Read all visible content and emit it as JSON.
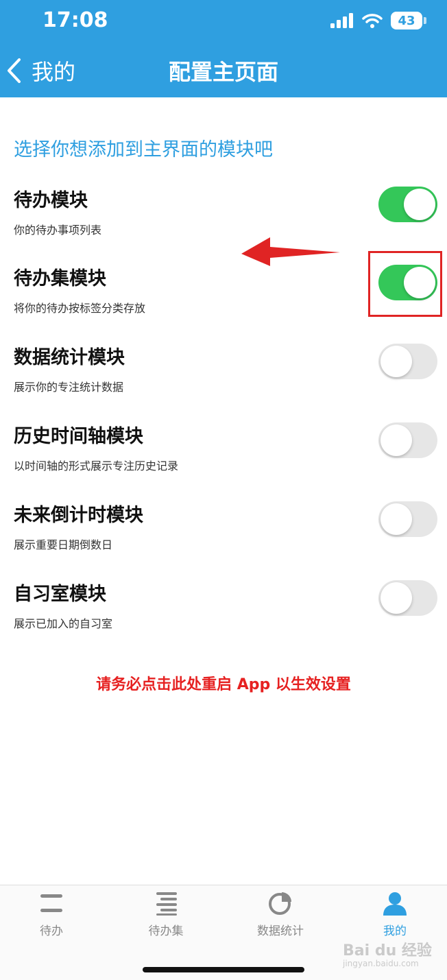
{
  "status_bar": {
    "time": "17:08",
    "battery": "43"
  },
  "nav": {
    "back_label": "我的",
    "title": "配置主页面"
  },
  "section_title": "选择你想添加到主界面的模块吧",
  "modules": [
    {
      "title": "待办模块",
      "desc": "你的待办事项列表",
      "enabled": true
    },
    {
      "title": "待办集模块",
      "desc": "将你的待办按标签分类存放",
      "enabled": true
    },
    {
      "title": "数据统计模块",
      "desc": "展示你的专注统计数据",
      "enabled": false
    },
    {
      "title": "历史时间轴模块",
      "desc": "以时间轴的形式展示专注历史记录",
      "enabled": false
    },
    {
      "title": "未来倒计时模块",
      "desc": "展示重要日期倒数日",
      "enabled": false
    },
    {
      "title": "自习室模块",
      "desc": "展示已加入的自习室",
      "enabled": false
    }
  ],
  "restart_text": "请务必点击此处重启 App 以生效设置",
  "tabs": [
    {
      "label": "待办",
      "icon": "todo-list-icon",
      "active": false
    },
    {
      "label": "待办集",
      "icon": "todo-collection-icon",
      "active": false
    },
    {
      "label": "数据统计",
      "icon": "pie-chart-icon",
      "active": false
    },
    {
      "label": "我的",
      "icon": "user-icon",
      "active": true
    }
  ],
  "watermark": {
    "main": "Bai du 经验",
    "sub": "jingyan.baidu.com"
  },
  "colors": {
    "header": "#2f9fe0",
    "toggle_on": "#34c759",
    "toggle_off": "#e6e6e6",
    "annotation_red": "#e02424",
    "restart_red": "#e62121"
  }
}
